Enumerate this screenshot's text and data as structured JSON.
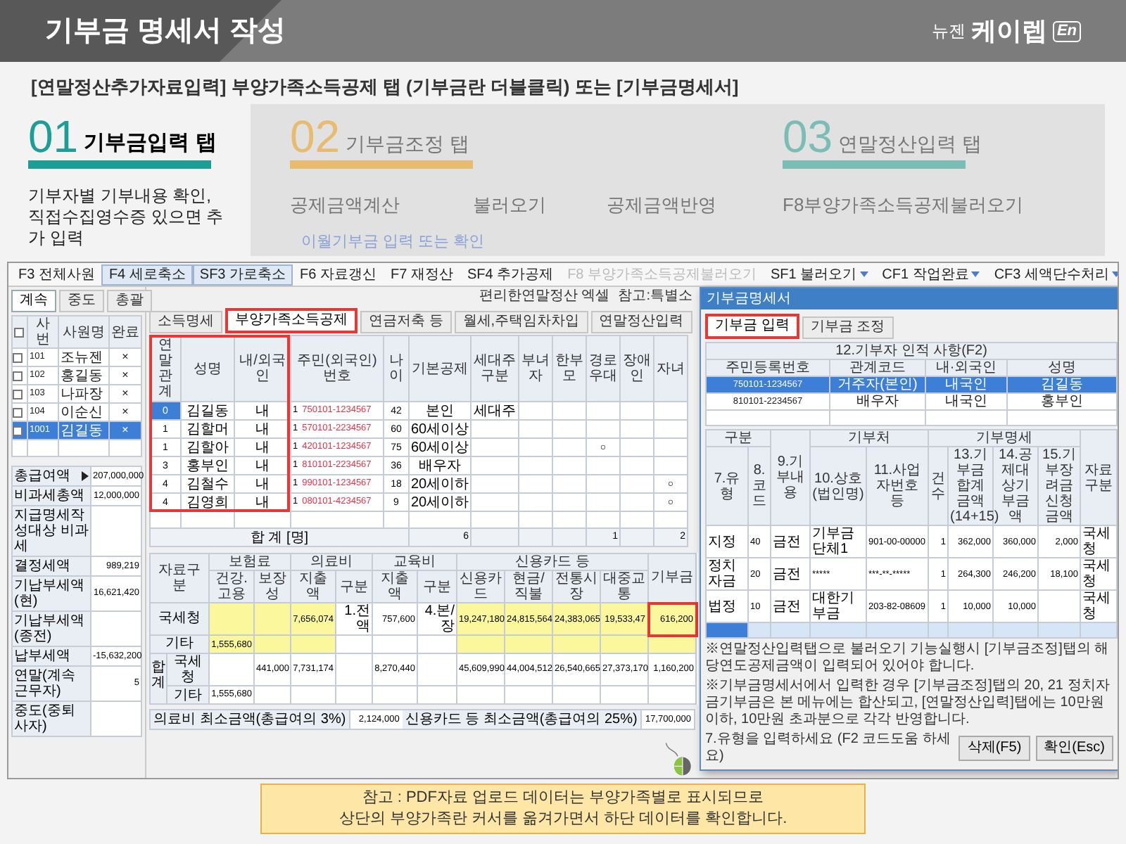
{
  "header": {
    "title": "기부금 명세서 작성",
    "logo_prefix": "뉴젠",
    "logo_name": "케이렙",
    "logo_badge": "En"
  },
  "instruction": "[연말정산추가자료입력] 부양가족소득공제 탭 (기부금란 더블클릭) 또는 [기부금명세서]",
  "steps": [
    {
      "number": "01",
      "label": "기부금입력 탭",
      "color": "#1a9e95",
      "selected": true
    },
    {
      "number": "02",
      "label": "기부금조정 탭",
      "color": "#e9bb6e",
      "selected": false
    },
    {
      "number": "03",
      "label": "연말정산입력 탭",
      "color": "#79bdb4",
      "selected": false
    }
  ],
  "step_description": "기부자별 기부내용 확인, 직접수집영수증 있으면 추가 입력",
  "step_actions": [
    "공제금액계산",
    "불러오기",
    "공제금액반영",
    "F8부양가족소득공제불러오기"
  ],
  "step_note": "이월기부금 입력 또는 확인",
  "app": {
    "toolbar": [
      {
        "label": "F3 전체사원",
        "kind": "button",
        "pressed": false,
        "disabled": false
      },
      {
        "label": "F4 세로축소",
        "kind": "button",
        "pressed": true,
        "disabled": false
      },
      {
        "label": "SF3 가로축소",
        "kind": "button",
        "pressed": true,
        "disabled": false
      },
      {
        "label": "F6 자료갱신",
        "kind": "button",
        "pressed": false,
        "disabled": false
      },
      {
        "label": "F7 재정산",
        "kind": "button",
        "pressed": false,
        "disabled": false
      },
      {
        "label": "SF4 추가공제",
        "kind": "button",
        "pressed": false,
        "disabled": false
      },
      {
        "label": "F8 부양가족소득공제불러오기",
        "kind": "button",
        "pressed": false,
        "disabled": true
      },
      {
        "label": "SF1 불러오기",
        "kind": "dropdown",
        "pressed": false,
        "disabled": false
      },
      {
        "label": "CF1 작업완료",
        "kind": "dropdown",
        "pressed": false,
        "disabled": false
      },
      {
        "label": "CF3 세액단수처리",
        "kind": "dropdown",
        "pressed": false,
        "disabled": false
      }
    ],
    "employee_tabs": [
      {
        "label": "계속",
        "selected": true
      },
      {
        "label": "중도",
        "selected": false
      },
      {
        "label": "총괄",
        "selected": false
      }
    ],
    "employees": {
      "all_checked": false,
      "columns": [
        "사번",
        "사원명",
        "완료"
      ],
      "rows": [
        {
          "id": "101",
          "name": "조뉴젠",
          "done": "×",
          "checked": false,
          "selected": false
        },
        {
          "id": "102",
          "name": "홍길동",
          "done": "×",
          "checked": false,
          "selected": false
        },
        {
          "id": "103",
          "name": "나파장",
          "done": "×",
          "checked": false,
          "selected": false
        },
        {
          "id": "104",
          "name": "이순신",
          "done": "×",
          "checked": false,
          "selected": false
        },
        {
          "id": "1001",
          "name": "김길동",
          "done": "×",
          "checked": false,
          "selected": true
        }
      ]
    },
    "summary": [
      {
        "label": "총급여액",
        "value": "207,000,000",
        "kind": "expandable"
      },
      {
        "label": "비과세총액",
        "value": "12,000,000",
        "kind": "plain"
      },
      {
        "label": "지급명세작성대상 비과세",
        "kind": "plain"
      },
      {
        "label": "결정세액",
        "value": "989,219",
        "kind": "plain"
      },
      {
        "label": "기납부세액(현)",
        "value": "16,621,420",
        "kind": "plain"
      },
      {
        "label": "기납부세액(종전)",
        "kind": "plain"
      },
      {
        "label": "납부세액",
        "value": "-15,632,200",
        "kind": "plain"
      },
      {
        "label": "연말(계속근무자)",
        "value": "5",
        "kind": "plain"
      },
      {
        "label": "중도(중퇴사자)",
        "kind": "plain"
      }
    ],
    "links": [
      "편리한연말정산 엑셀",
      "참고:특별소"
    ],
    "main_tabs": [
      {
        "label": "소득명세",
        "selected": false
      },
      {
        "label": "부양가족소득공제",
        "selected": true
      },
      {
        "label": "연금저축 등",
        "selected": false
      },
      {
        "label": "월세,주택임차차입",
        "selected": false
      },
      {
        "label": "연말정산입력",
        "selected": false
      }
    ],
    "dependents": {
      "columns": [
        "연말관계",
        "성명",
        "내/외국인",
        "주민(외국인)번호",
        "나이",
        "기본공제",
        "세대주구분",
        "부녀자",
        "한부모",
        "경로우대",
        "장애인",
        "자녀"
      ],
      "rows": [
        {
          "relation": "0",
          "name": "김길동",
          "nationality": "내",
          "id_type": "1",
          "resident_no": "750101-1234567",
          "age": "42",
          "basic": "본인",
          "householder": "세대주",
          "selected": true
        },
        {
          "relation": "1",
          "name": "김할머",
          "nationality": "내",
          "id_type": "1",
          "resident_no": "570101-2234567",
          "age": "60",
          "basic": "60세이상",
          "selected": false
        },
        {
          "relation": "1",
          "name": "김할아",
          "nationality": "내",
          "id_type": "1",
          "resident_no": "420101-1234567",
          "age": "75",
          "basic": "60세이상",
          "senior": "○",
          "selected": false
        },
        {
          "relation": "3",
          "name": "홍부인",
          "nationality": "내",
          "id_type": "1",
          "resident_no": "810101-2234567",
          "age": "36",
          "basic": "배우자",
          "selected": false
        },
        {
          "relation": "4",
          "name": "김철수",
          "nationality": "내",
          "id_type": "1",
          "resident_no": "990101-1234567",
          "age": "18",
          "basic": "20세이하",
          "child": "○",
          "selected": false
        },
        {
          "relation": "4",
          "name": "김영희",
          "nationality": "내",
          "id_type": "1",
          "resident_no": "080101-4234567",
          "age": "9",
          "basic": "20세이하",
          "child": "○",
          "selected": false
        }
      ],
      "total": {
        "label": "합 계 [명]",
        "basic": "6",
        "senior": "1",
        "child": "2"
      }
    },
    "deductions": {
      "label_header": "자료구분",
      "groups": [
        {
          "label": "보험료",
          "columns": [
            {
              "label": "건강.고용",
              "editable": true,
              "selected": false
            },
            {
              "label": "보장성",
              "editable": true,
              "selected": false
            }
          ]
        },
        {
          "label": "의료비",
          "columns": [
            {
              "label": "지출액",
              "editable": true,
              "selected": false
            },
            {
              "label": "구분",
              "editable": false,
              "selected": false
            }
          ]
        },
        {
          "label": "교육비",
          "columns": [
            {
              "label": "지출액",
              "editable": false,
              "selected": false
            },
            {
              "label": "구분",
              "editable": false,
              "selected": false
            }
          ]
        },
        {
          "label": "신용카드 등",
          "columns": [
            {
              "label": "신용카드",
              "editable": true,
              "selected": false
            },
            {
              "label": "현금/직불",
              "editable": true,
              "selected": false
            },
            {
              "label": "전통시장",
              "editable": true,
              "selected": false
            },
            {
              "label": "대중교통",
              "editable": true,
              "selected": false
            }
          ]
        },
        {
          "label": "기부금",
          "editable": true,
          "selected": true
        }
      ],
      "rows": [
        {
          "label": "국세청",
          "selected": true,
          "cells": [
            null,
            null,
            "7,656,074",
            "1.전액",
            "757,600",
            "4.본/장",
            "19,247,180",
            "24,815,564",
            "24,383,065",
            "19,533,47",
            "616,200"
          ]
        },
        {
          "label": "기타",
          "selected": false,
          "cells": [
            "1,555,680",
            null,
            null,
            null,
            null,
            null,
            null,
            null,
            null,
            null,
            null
          ]
        }
      ],
      "total_label": "합계",
      "totals": [
        {
          "label": "국세청",
          "cells": [
            null,
            "441,000",
            "7,731,174",
            null,
            "8,270,440",
            null,
            "45,609,990",
            "44,004,512",
            "26,540,665",
            "27,373,170",
            "1,160,200"
          ]
        },
        {
          "label": "기타",
          "cells": [
            "1,555,680",
            null,
            null,
            null,
            null,
            null,
            null,
            null,
            null,
            null,
            null
          ]
        }
      ],
      "minimums": [
        {
          "label": "의료비 최소금액(총급여의 3%)",
          "value": "2,124,000"
        },
        {
          "label": "신용카드 등 최소금액(총급여의 25%)",
          "value": "17,700,000"
        }
      ]
    }
  },
  "dialog": {
    "title": "기부금명세서",
    "tabs": [
      {
        "label": "기부금 입력",
        "selected": true
      },
      {
        "label": "기부금 조정",
        "selected": false
      }
    ],
    "donors": {
      "title": "12.기부자 인적 사항(F2)",
      "columns": [
        "주민등록번호",
        "관계코드",
        "내·외국인",
        "성명"
      ],
      "rows": [
        {
          "cells": [
            "750101-1234567",
            "거주자(본인)",
            "내국인",
            "김길동"
          ],
          "selected": true
        },
        {
          "cells": [
            "810101-2234567",
            "배우자",
            "내국인",
            "홍부인"
          ],
          "selected": false
        }
      ]
    },
    "donations": {
      "groups": [
        {
          "label": "구분",
          "columns": [
            "7.유형",
            "8.코드"
          ]
        },
        {
          "label": "9.기부내용"
        },
        {
          "label": "기부처",
          "columns": [
            "10.상호(법인명)",
            "11.사업자번호 등"
          ]
        },
        {
          "label": "기부명세",
          "columns": [
            "건수",
            "13.기부금합계금액(14+15)",
            "14.공제대상기부금액",
            "15.기부장려금신청금액"
          ]
        },
        {
          "label": "자료구분"
        }
      ],
      "rows": [
        [
          "지정",
          "40",
          "금전",
          "기부금단체1",
          "901-00-00000",
          "1",
          "362,000",
          "360,000",
          "2,000",
          "국세청"
        ],
        [
          "정치자금",
          "20",
          "금전",
          "*****",
          "***-**-*****",
          "1",
          "264,300",
          "246,200",
          "18,100",
          "국세청"
        ],
        [
          "법정",
          "10",
          "금전",
          "대한기부금",
          "203-82-08609",
          "1",
          "10,000",
          "10,000",
          null,
          "국세청"
        ]
      ]
    },
    "notes": [
      "※연말정산입력탭으로 불러오기 기능실행시 [기부금조정]탭의 해당연도공제금액이 입력되어 있어야 합니다.",
      "※기부금명세서에서 입력한 경우 [기부금조정]탭의 20, 21 정치자금기부금은 본 메뉴에는 합산되고, [연말정산입력]탭에는 10만원이하, 10만원 초과분으로 각각 반영합니다."
    ],
    "hint": "7.유형을 입력하세요 (F2 코드도움 하세요)",
    "buttons": [
      "삭제(F5)",
      "확인(Esc)"
    ]
  },
  "footnote": [
    "참고 : PDF자료 업로드 데이터는 부양가족별로 표시되므로",
    "상단의 부양가족란 커서를 옮겨가면서 하단 데이터를 확인합니다."
  ]
}
